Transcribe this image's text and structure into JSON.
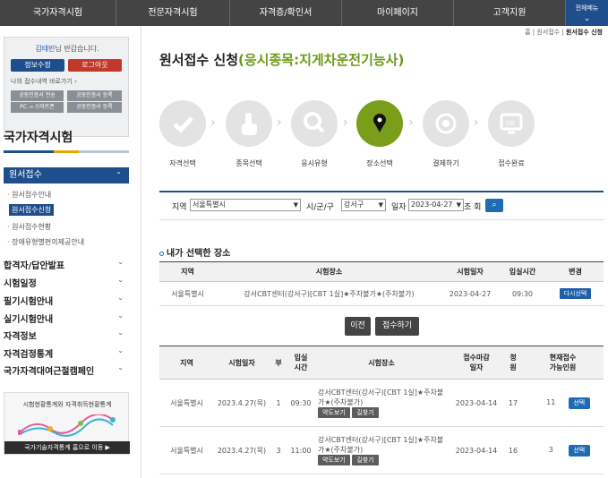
{
  "topnav": {
    "items": [
      "국가자격시험",
      "전문자격시험",
      "자격증/확인서",
      "마이페이지",
      "고객지원"
    ],
    "allmenu": "전체메뉴"
  },
  "sidebar": {
    "greeting_name": "김태빈",
    "greeting_suffix": "님 반갑습니다.",
    "info_button": "정보수정",
    "logout_button": "로그아웃",
    "history_link": "나의 접수내역 바로가기",
    "mini_buttons": [
      "공동인증서 전송",
      "공동인증서 등록",
      "PC → 스마트폰",
      "공동인증서 등록"
    ],
    "title": "국가자격시험",
    "section": "원서접수",
    "subitems": [
      "원서접수안내",
      "원서접수신청",
      "원서접수현황",
      "장애유형별편의제공안내"
    ],
    "menus": [
      "합격자/답안발표",
      "시험일정",
      "필기시험안내",
      "실기시험안내",
      "자격정보",
      "자격검정통계",
      "국가자격대여근절캠페인"
    ],
    "banner_title": "시험현황통계와 자격취득현황통계",
    "banner_footer": "국가기술자격통계 홈으로 이동 ▶"
  },
  "breadcrumb": {
    "home": "홈",
    "mid": "원서접수",
    "current": "원서접수 신청"
  },
  "page": {
    "title_main": "원서접수 신청",
    "title_sub": "(응시종목:지게차운전기능사)"
  },
  "steps": [
    "자격선택",
    "종목선택",
    "응시유형",
    "장소선택",
    "결제하기",
    "접수완료"
  ],
  "search": {
    "region_label": "지역",
    "region_value": "서울특별시",
    "city_label": "시/군/구",
    "city_value": "강서구",
    "date_label": "일자",
    "date_value": "2023-04-27",
    "after_label": "조 회"
  },
  "selected": {
    "title": "내가 선택한 장소",
    "headers": [
      "지역",
      "시험장소",
      "시험일자",
      "입실시간",
      "변경"
    ],
    "row": {
      "region": "서울특별시",
      "place": "강서CBT센터(강서구)[CBT 1실]★주차불가★(주차불가)",
      "date": "2023-04-27",
      "time": "09:30",
      "action": "다시선택"
    }
  },
  "actions": {
    "prev": "이전",
    "submit": "접수하기"
  },
  "schedule": {
    "headers": [
      "지역",
      "시험일자",
      "부",
      "입실\n시간",
      "시험장소",
      "접수마감\n일자",
      "정\n원",
      "현재접수\n가능인원"
    ],
    "rows": [
      {
        "region": "서울특별시",
        "date": "2023.4.27(목)",
        "part": "1",
        "time": "09:30",
        "place": "강서CBT센터(강서구)[CBT 1실]★주차불가★(주차불가)",
        "deadline": "2023-04-14",
        "capacity": "17",
        "available": "11",
        "map_btn": "약도보기",
        "route_btn": "길찾기",
        "select": "선택"
      },
      {
        "region": "서울특별시",
        "date": "2023.4.27(목)",
        "part": "3",
        "time": "11:00",
        "place": "강서CBT센터(강서구)[CBT 1실]★주차불가★(주차불가)",
        "deadline": "2023-04-14",
        "capacity": "16",
        "available": "3",
        "map_btn": "약도보기",
        "route_btn": "길찾기",
        "select": "선택"
      }
    ]
  }
}
